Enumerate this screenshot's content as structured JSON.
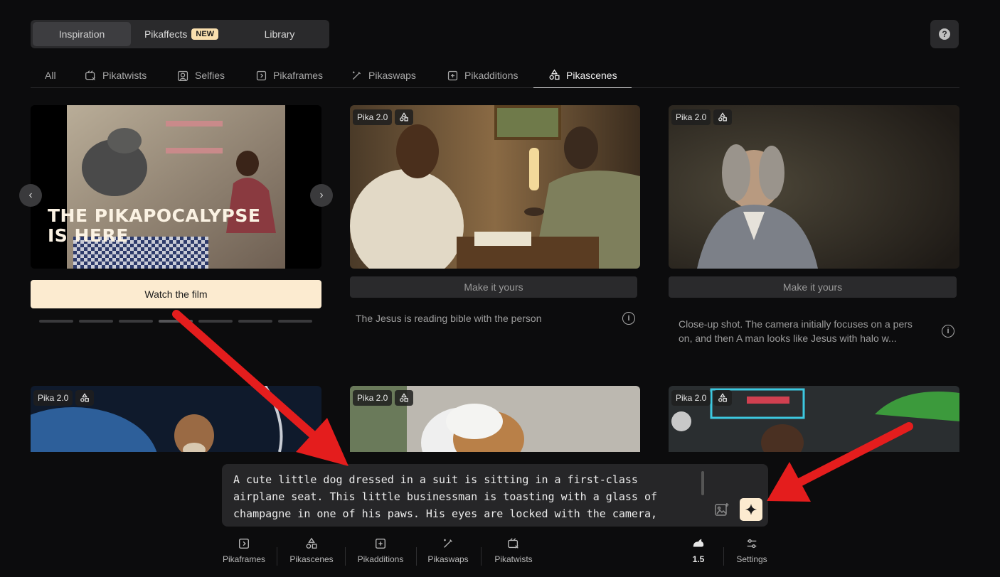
{
  "top_tabs": [
    {
      "label": "Inspiration"
    },
    {
      "label": "Pikaffects",
      "badge": "NEW"
    },
    {
      "label": "Library"
    }
  ],
  "help_label": "?",
  "categories": [
    {
      "label": "All"
    },
    {
      "label": "Pikatwists"
    },
    {
      "label": "Selfies"
    },
    {
      "label": "Pikaframes"
    },
    {
      "label": "Pikaswaps"
    },
    {
      "label": "Pikadditions"
    },
    {
      "label": "Pikascenes"
    }
  ],
  "hero": {
    "title_line1": "THE PIKAPOCALYPSE",
    "title_line2": "IS HERE",
    "watch_label": "Watch the film",
    "prev": "‹",
    "next": "›",
    "slides_total": 7,
    "slide_active": 4
  },
  "cards": [
    {
      "model": "Pika 2.0",
      "action": "Make it yours",
      "caption": "The Jesus is reading bible with the person"
    },
    {
      "model": "Pika 2.0",
      "action": "Make it yours",
      "caption_line1": "Close-up shot. The camera initially focuses on a pers",
      "caption_line2": "on, and then A man looks like Jesus with halo w..."
    },
    {
      "model": "Pika 2.0"
    },
    {
      "model": "Pika 2.0"
    },
    {
      "model": "Pika 2.0"
    }
  ],
  "info_label": "i",
  "prompt": {
    "line1": "A cute little dog dressed in a suit is sitting in a first-class",
    "line2": "airplane seat. This little businessman is toasting with a glass of",
    "line3": "champagne in one of his paws. His eyes are locked with the camera,"
  },
  "toolbar": [
    {
      "label": "Pikaframes"
    },
    {
      "label": "Pikascenes"
    },
    {
      "label": "Pikadditions"
    },
    {
      "label": "Pikaswaps"
    },
    {
      "label": "Pikatwists"
    },
    {
      "label": "1.5"
    },
    {
      "label": "Settings"
    }
  ],
  "colors": {
    "background": "#0c0c0d",
    "accent": "#fcebd0",
    "badge": "#f9dfae",
    "annotation_arrow": "#e41d1d"
  }
}
